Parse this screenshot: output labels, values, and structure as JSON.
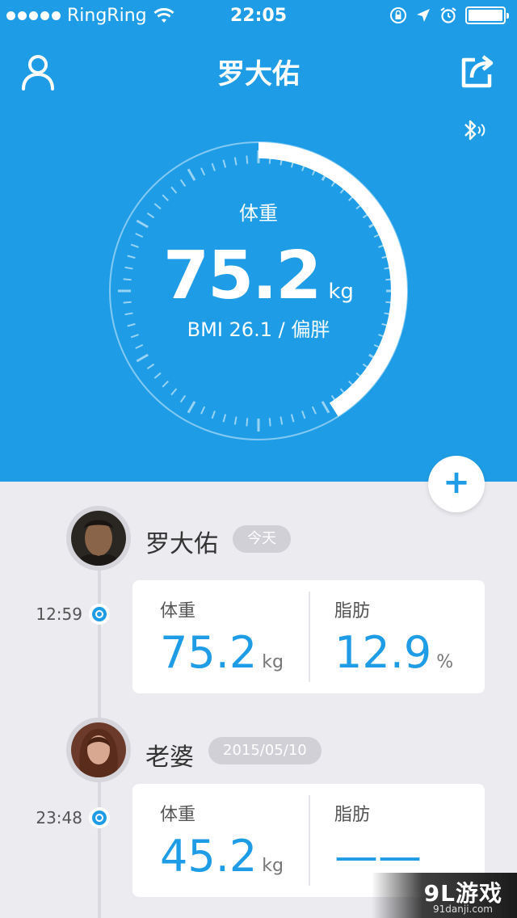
{
  "status_bar": {
    "carrier": "RingRing",
    "time": "22:05",
    "icons": [
      "signal-dots",
      "wifi-icon",
      "orientation-lock-icon",
      "location-icon",
      "alarm-icon",
      "battery-icon"
    ],
    "battery_level": 1.0
  },
  "header": {
    "title": "罗大佑",
    "left_icon": "user-icon",
    "right_icon": "share-icon",
    "bluetooth_icon": "bluetooth-icon"
  },
  "gauge": {
    "label": "体重",
    "value": "75.2",
    "unit": "kg",
    "bmi": "BMI 26.1  /  偏胖",
    "progress": 0.41
  },
  "add_button": {
    "label": "+"
  },
  "records": [
    {
      "name": "罗大佑",
      "tag": "今天",
      "time": "12:59",
      "weight_label": "体重",
      "weight_value": "75.2",
      "weight_unit": "kg",
      "fat_label": "脂肪",
      "fat_value": "12.9",
      "fat_unit": "%"
    },
    {
      "name": "老婆",
      "tag": "2015/05/10",
      "time": "23:48",
      "weight_label": "体重",
      "weight_value": "45.2",
      "weight_unit": "kg",
      "fat_label": "脂肪",
      "fat_value": "——",
      "fat_unit": ""
    }
  ],
  "watermark": {
    "main": "9L游戏",
    "sub": "91danji.com"
  },
  "colors": {
    "primary_blue": "#1e9de6",
    "background": "#ebebf0",
    "card": "#ffffff"
  }
}
